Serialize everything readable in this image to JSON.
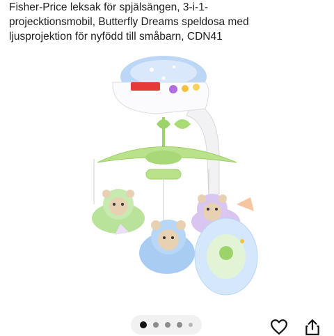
{
  "product": {
    "title_lines": [
      "Fisher-Price leksak för spjälsängen, 3-i-1-",
      "projecktionsmobil, Butterfly Dreams speldosa med",
      "ljusprojektion för nyfödd till småbarn, CDN41"
    ],
    "brand_logo_text": "Fisher-Price"
  },
  "carousel": {
    "total_dots": 5,
    "active_index": 0
  },
  "actions": {
    "favorite_icon": "heart-icon",
    "share_icon": "share-icon"
  },
  "colors": {
    "dot_active": "#111111",
    "dot_inactive": "#8c8c8c",
    "text": "#1f1f1f"
  }
}
